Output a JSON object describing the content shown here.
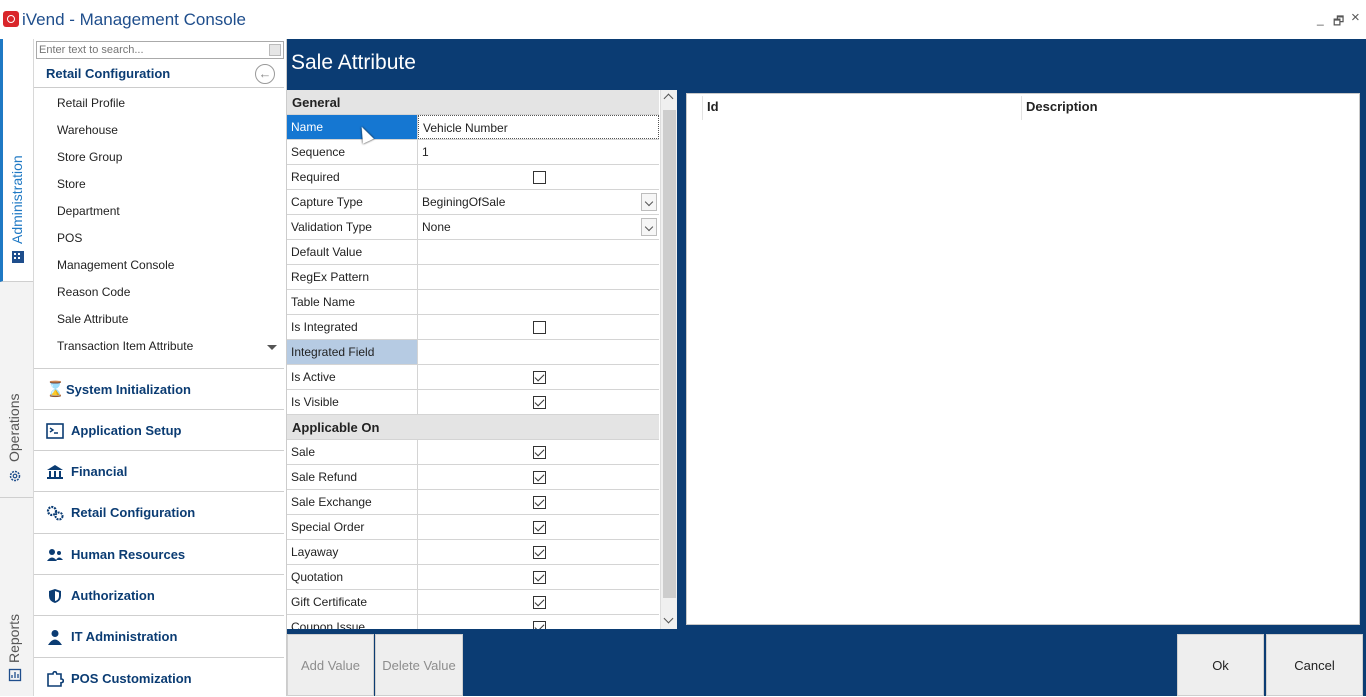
{
  "window": {
    "title": "iVend - Management Console",
    "minimize": "_",
    "restore": "🗗",
    "close": "×"
  },
  "vtabs": [
    {
      "label": "Administration",
      "icon": "building-icon"
    },
    {
      "label": "Operations",
      "icon": "gear-icon"
    },
    {
      "label": "Reports",
      "icon": "report-icon"
    }
  ],
  "nav": {
    "search_placeholder": "Enter text to search...",
    "section_title": "Retail Configuration",
    "items": [
      "Retail Profile",
      "Warehouse",
      "Store Group",
      "Store",
      "Department",
      "POS",
      "Management Console",
      "Reason Code",
      "Sale Attribute",
      "Transaction Item Attribute"
    ],
    "modules": [
      {
        "label": "System Initialization",
        "icon": "hourglass-icon"
      },
      {
        "label": "Application Setup",
        "icon": "terminal-icon"
      },
      {
        "label": "Financial",
        "icon": "bank-icon"
      },
      {
        "label": "Retail Configuration",
        "icon": "gears-icon"
      },
      {
        "label": "Human Resources",
        "icon": "people-icon"
      },
      {
        "label": "Authorization",
        "icon": "shield-icon"
      },
      {
        "label": "IT Administration",
        "icon": "person-icon"
      },
      {
        "label": "POS Customization",
        "icon": "puzzle-icon"
      }
    ]
  },
  "page": {
    "title": "Sale Attribute"
  },
  "grid": {
    "general_label": "General",
    "general": [
      {
        "label": "Name",
        "value": "Vehicle Number"
      },
      {
        "label": "Sequence",
        "value": "1"
      },
      {
        "label": "Required",
        "value": ""
      },
      {
        "label": "Capture Type",
        "value": "BeginingOfSale"
      },
      {
        "label": "Validation Type",
        "value": "None"
      },
      {
        "label": "Default Value",
        "value": ""
      },
      {
        "label": "RegEx Pattern",
        "value": ""
      },
      {
        "label": "Table Name",
        "value": ""
      },
      {
        "label": "Is Integrated",
        "value": ""
      },
      {
        "label": "Integrated Field",
        "value": ""
      },
      {
        "label": "Is Active",
        "value": ""
      },
      {
        "label": "Is Visible",
        "value": ""
      }
    ],
    "applicable_label": "Applicable On",
    "applicable": [
      "Sale",
      "Sale Refund",
      "Sale Exchange",
      "Special Order",
      "Layaway",
      "Quotation",
      "Gift Certificate",
      "Coupon Issue"
    ]
  },
  "listview": {
    "columns": [
      "Id",
      "Description"
    ]
  },
  "buttons": {
    "add": "Add Value",
    "delete": "Delete Value",
    "ok": "Ok",
    "cancel": "Cancel"
  },
  "colors": {
    "accent": "#0b3c73",
    "selected": "#1577d2"
  }
}
